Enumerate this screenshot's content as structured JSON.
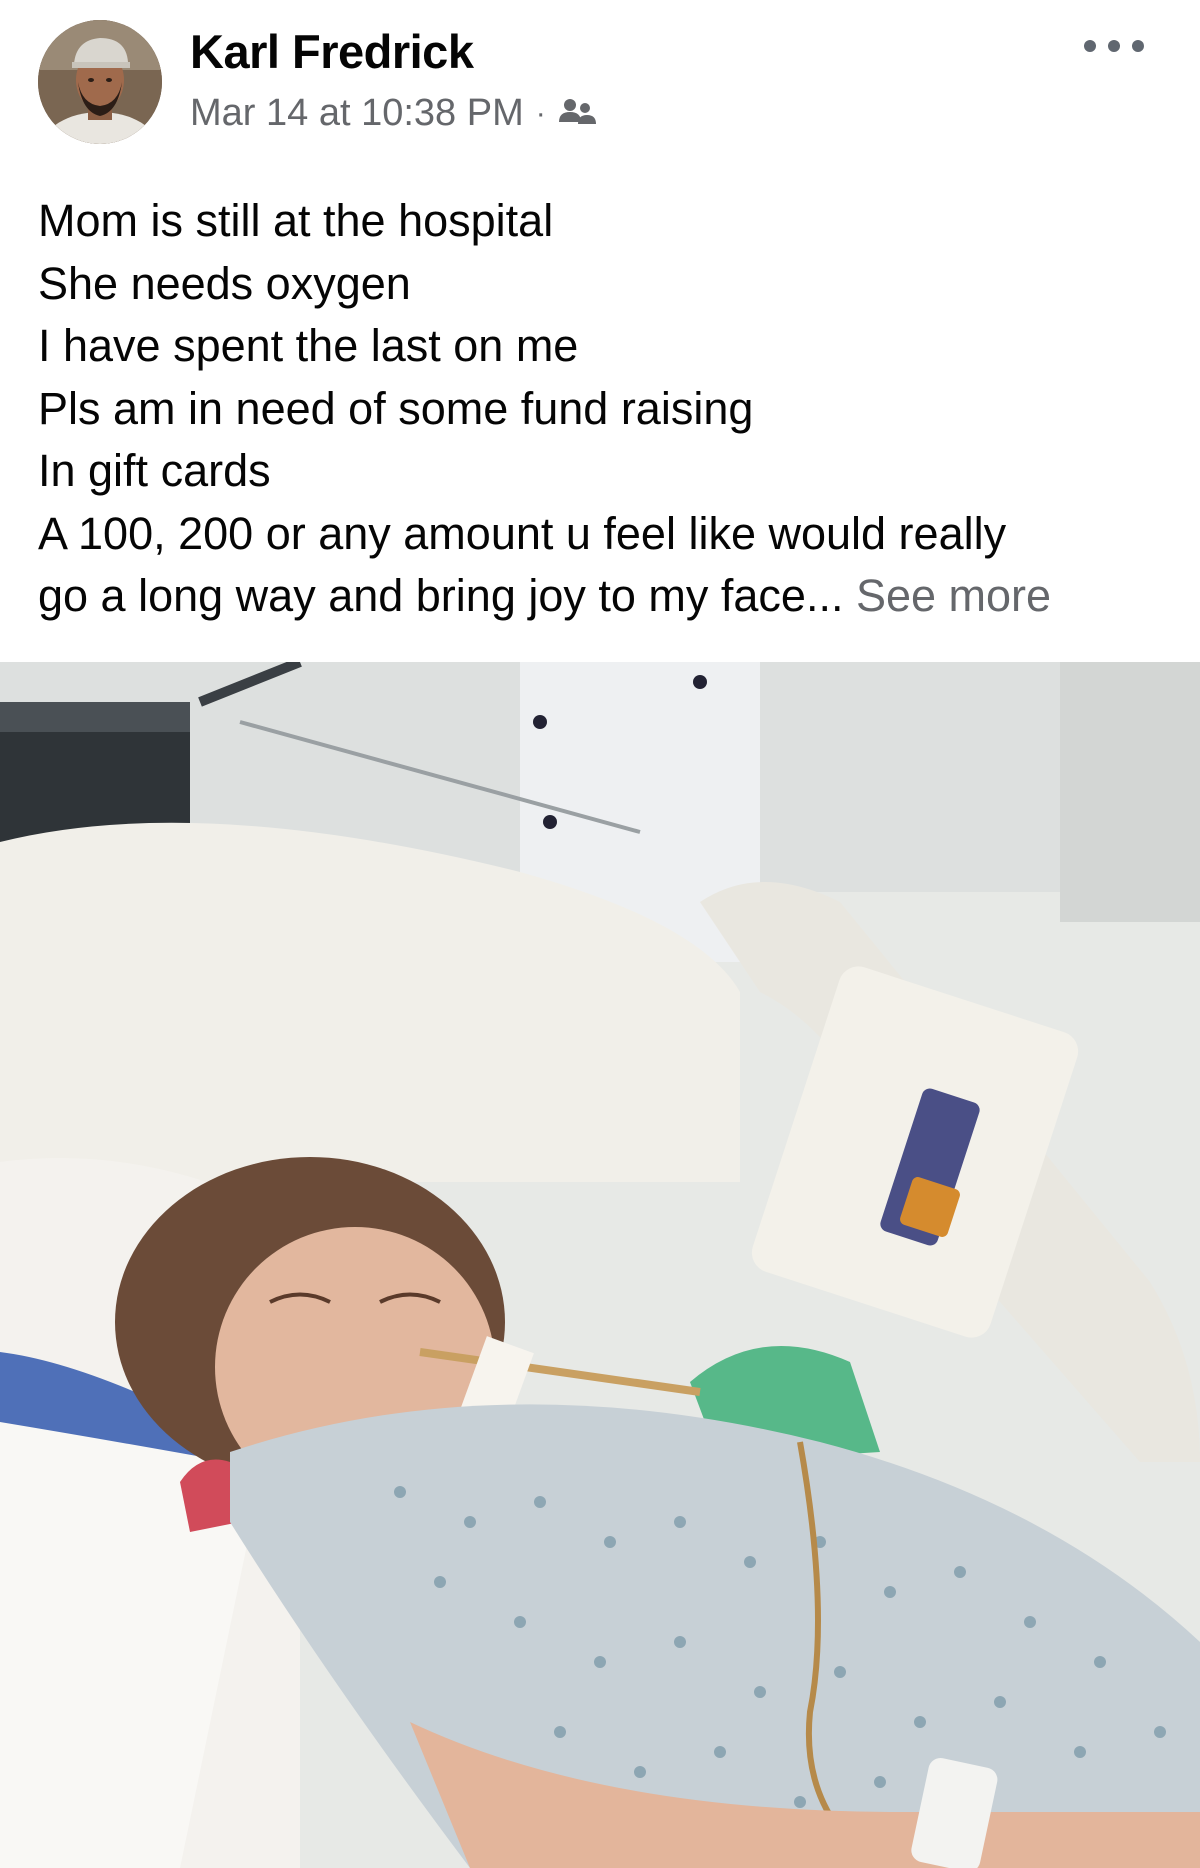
{
  "post": {
    "author": "Karl Fredrick",
    "timestamp": "Mar 14 at 10:38 PM",
    "separator": "·",
    "audience_icon": "friends-icon",
    "menu_icon": "more-options-icon",
    "lines": [
      "Mom is still at the hospital",
      "She needs oxygen",
      "I have spent the last on me",
      "Pls am in need of some fund raising",
      "In gift cards",
      "A 100, 200 or any amount u feel like would really"
    ],
    "last_line": "go a long way and bring joy to my face...",
    "see_more": "See more"
  },
  "colors": {
    "primary_text": "#050505",
    "secondary_text": "#65676b",
    "background": "#ffffff"
  }
}
